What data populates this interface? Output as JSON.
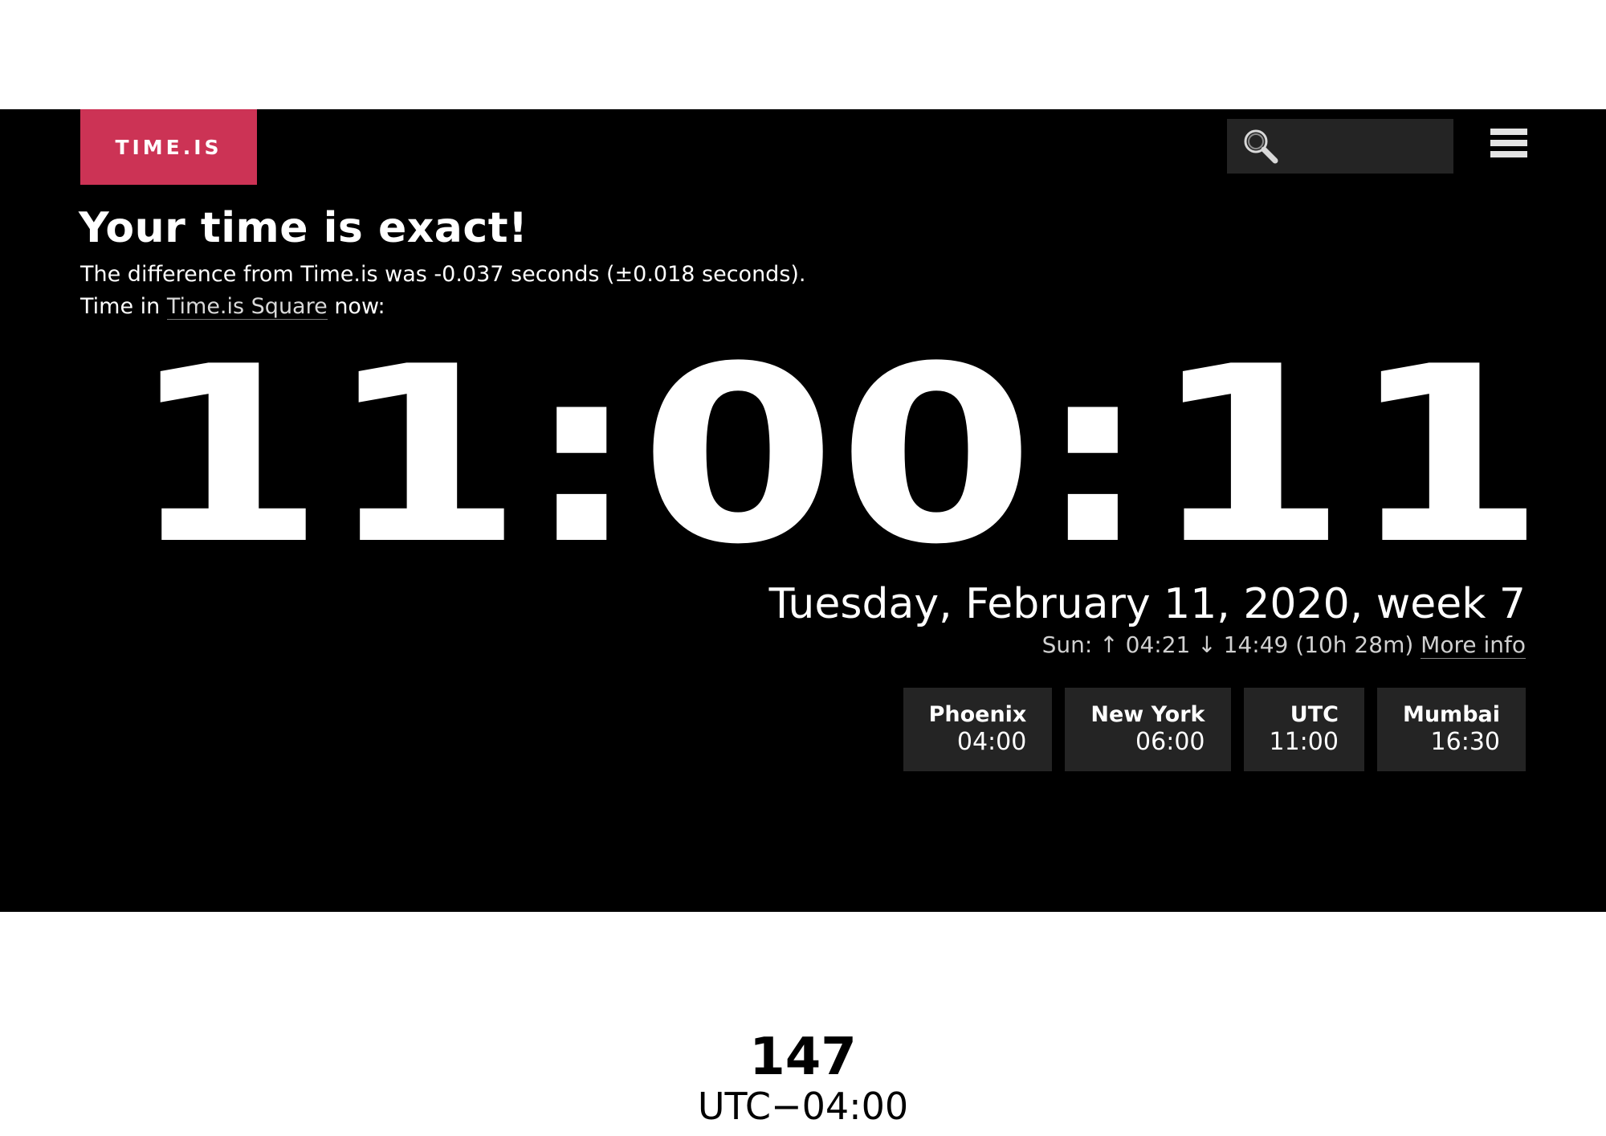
{
  "header": {
    "logo_text": "TIME.IS",
    "logo_color": "#cc3355",
    "search_placeholder": "",
    "search_bg_color": "#242424",
    "icons": {
      "search": "search-icon",
      "menu": "hamburger-menu-icon"
    }
  },
  "main": {
    "headline": "Your time is exact!",
    "difference_text": "The difference from Time.is was -0.037 seconds (±0.018 seconds).",
    "place_prefix": "Time in ",
    "place_link": "Time.is Square",
    "place_suffix": " now:",
    "clock": "11:00:11",
    "date": "Tuesday, February 11, 2020, week 7",
    "sun": {
      "prefix": "Sun: ",
      "sunrise_arrow": "↑",
      "sunrise": "04:21",
      "sunset_arrow": "↓",
      "sunset": "14:49",
      "daylength": "(10h 28m)",
      "more_info": "More info"
    },
    "cities": [
      {
        "name": "Phoenix",
        "time": "04:00"
      },
      {
        "name": "New York",
        "time": "06:00"
      },
      {
        "name": "UTC",
        "time": "11:00"
      },
      {
        "name": "Mumbai",
        "time": "16:30"
      }
    ]
  },
  "caption": {
    "number": "147",
    "timezone": "UTC−04:00"
  }
}
